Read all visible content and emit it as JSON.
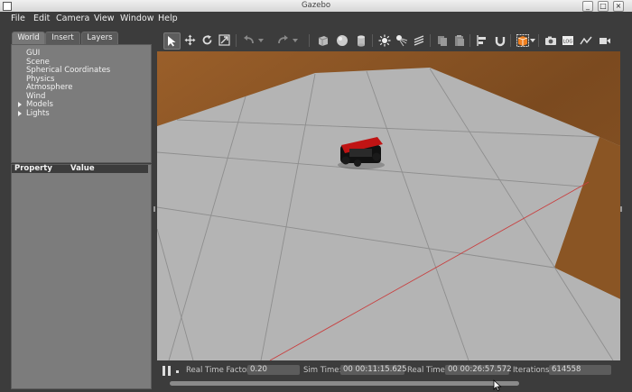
{
  "window": {
    "title": "Gazebo"
  },
  "menu": [
    "File",
    "Edit",
    "Camera",
    "View",
    "Window",
    "Help"
  ],
  "tabs": [
    "World",
    "Insert",
    "Layers"
  ],
  "tree": [
    {
      "label": "GUI",
      "expandable": false
    },
    {
      "label": "Scene",
      "expandable": false
    },
    {
      "label": "Spherical Coordinates",
      "expandable": false
    },
    {
      "label": "Physics",
      "expandable": false
    },
    {
      "label": "Atmosphere",
      "expandable": false
    },
    {
      "label": "Wind",
      "expandable": false
    },
    {
      "label": "Models",
      "expandable": true
    },
    {
      "label": "Lights",
      "expandable": true
    }
  ],
  "properties": {
    "col_property": "Property",
    "col_value": "Value"
  },
  "toolbar": {
    "icons": [
      "select-arrow-icon",
      "translate-icon",
      "rotate-icon",
      "scale-icon",
      "undo-icon",
      "undo-dropdown-icon",
      "redo-icon",
      "redo-dropdown-icon",
      "box-icon",
      "sphere-icon",
      "cylinder-icon",
      "point-light-icon",
      "spot-light-icon",
      "directional-light-icon",
      "copy-icon",
      "paste-icon",
      "align-icon",
      "snap-icon",
      "change-view-icon",
      "view-dropdown-icon",
      "screenshot-icon",
      "log-icon",
      "plot-icon",
      "video-icon"
    ],
    "log_label": "LOG"
  },
  "status": {
    "rtf_label": "Real Time Factor:",
    "rtf_value": "0.20",
    "sim_label": "Sim Time:",
    "sim_value": "00 00:11:15.625",
    "real_label": "Real Time:",
    "real_value": "00 00:26:57.572",
    "iter_label": "Iterations:",
    "iter_value": "614558"
  },
  "colors": {
    "panel": "#3c3c3c",
    "ground": "#b4b4b4",
    "wall": "#8a5524",
    "robot": "#c01414",
    "axis": "#c84040"
  }
}
